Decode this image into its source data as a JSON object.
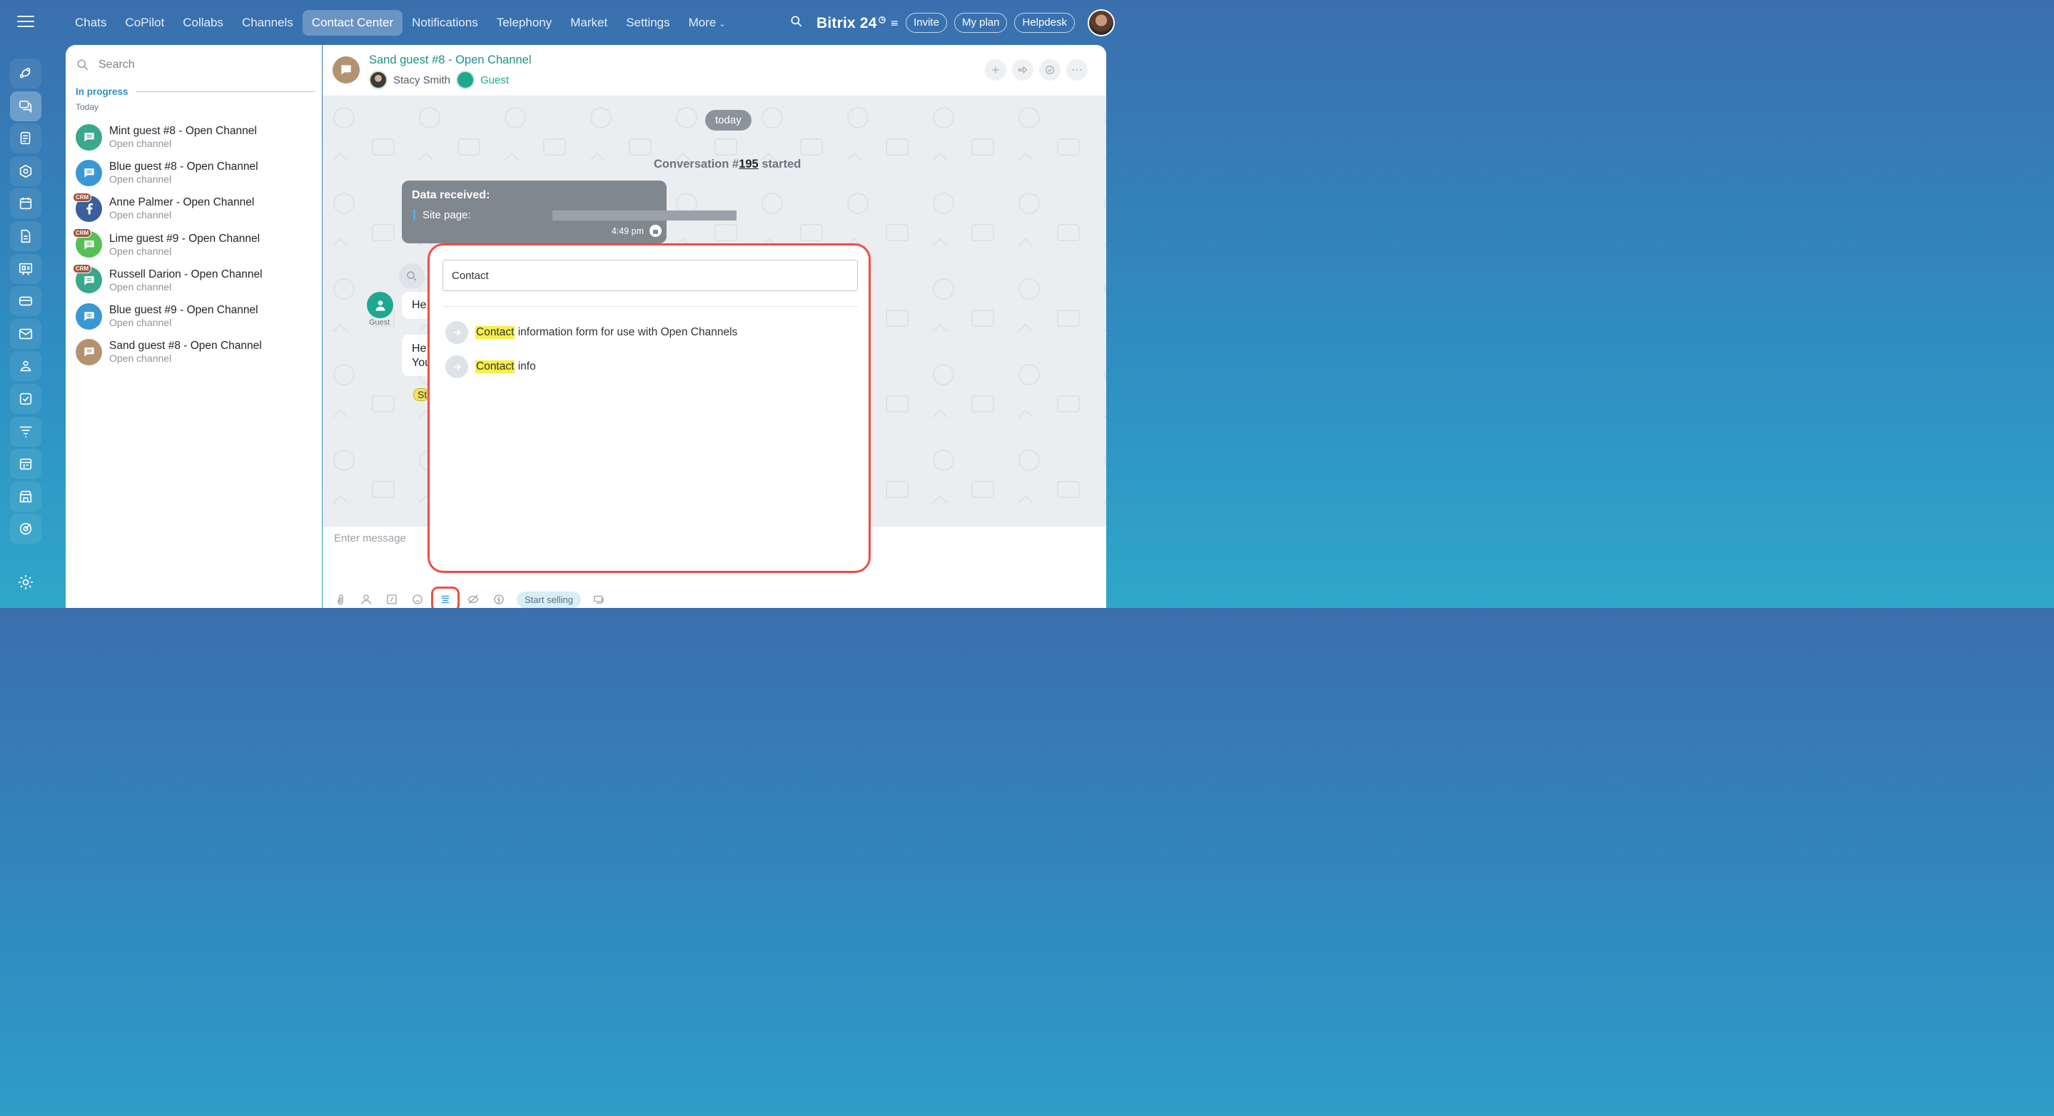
{
  "nav": {
    "items": [
      "Chats",
      "CoPilot",
      "Collabs",
      "Channels",
      "Contact Center",
      "Notifications",
      "Telephony",
      "Market",
      "Settings"
    ],
    "more_label": "More",
    "active": "Contact Center"
  },
  "header_right": {
    "brand": "Bitrix 24",
    "invite": "Invite",
    "my_plan": "My plan",
    "helpdesk": "Helpdesk"
  },
  "sidebar_icons": [
    "feed-icon",
    "chat-icon",
    "docs-icon",
    "hexagon-icon",
    "calendar-icon",
    "file-icon",
    "board-icon",
    "card-icon",
    "mail-icon",
    "team-icon",
    "check-icon",
    "funnel-icon",
    "schedule-icon",
    "store-icon",
    "target-icon"
  ],
  "list": {
    "search_placeholder": "Search",
    "section": "In progress",
    "day": "Today",
    "items": [
      {
        "title": "Mint guest #8 - Open Channel",
        "subtitle": "Open channel",
        "color": "#3aa88a",
        "crm": false,
        "icon": "chat"
      },
      {
        "title": "Blue guest #8 - Open Channel",
        "subtitle": "Open channel",
        "color": "#3a97d3",
        "crm": false,
        "icon": "chat"
      },
      {
        "title": "Anne Palmer - Open Channel",
        "subtitle": "Open channel",
        "color": "#3b5e9c",
        "crm": true,
        "icon": "facebook"
      },
      {
        "title": "Lime guest #9 - Open Channel",
        "subtitle": "Open channel",
        "color": "#55c155",
        "crm": true,
        "icon": "chat"
      },
      {
        "title": "Russell Darion - Open Channel",
        "subtitle": "Open channel",
        "color": "#3aa88a",
        "crm": true,
        "icon": "chat"
      },
      {
        "title": "Blue guest #9 - Open Channel",
        "subtitle": "Open channel",
        "color": "#3a97d3",
        "crm": false,
        "icon": "chat"
      },
      {
        "title": "Sand guest #8 - Open Channel",
        "subtitle": "Open channel",
        "color": "#b49270",
        "crm": false,
        "icon": "chat"
      }
    ]
  },
  "conversation": {
    "title": "Sand guest #8 - Open Channel",
    "operator": "Stacy Smith",
    "guest_label": "Guest",
    "date_pill": "today",
    "started_prefix": "Conversation #",
    "started_number": "195",
    "started_suffix": " started",
    "data_received_title": "Data received:",
    "site_page_label": "Site page:",
    "message_time": "4:49 pm",
    "guest_caption": "Guest",
    "bubble1": "He",
    "bubble2_line1": "He",
    "bubble2_line2": "You",
    "chip_text": "St",
    "composer_placeholder": "Enter message",
    "start_selling": "Start selling"
  },
  "popup": {
    "query": "Contact",
    "results": [
      {
        "highlight": "Contact",
        "rest": " information form for use with Open Channels"
      },
      {
        "highlight": "Contact",
        "rest": " info"
      }
    ]
  }
}
